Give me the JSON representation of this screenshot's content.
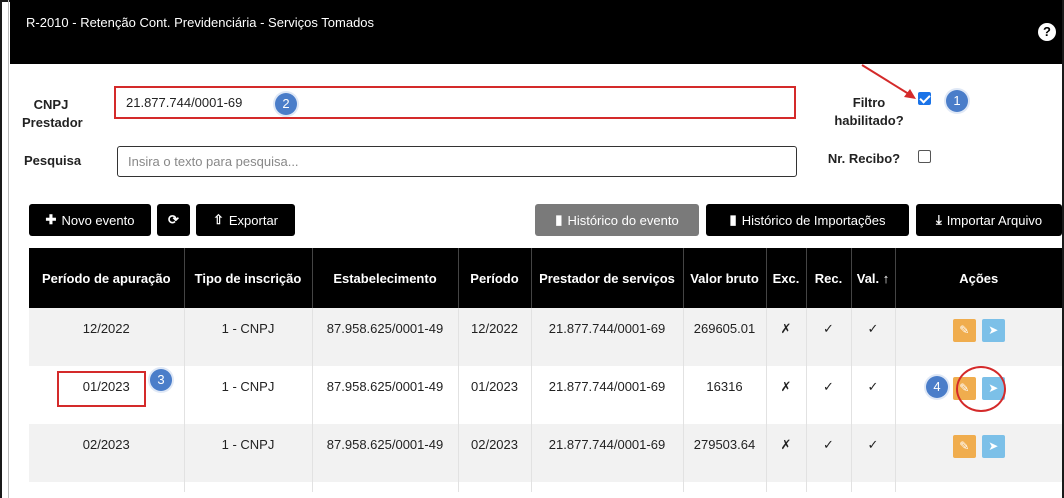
{
  "header": {
    "title": "R-2010 - Retenção Cont. Previdenciária - Serviços Tomados",
    "help_icon": "question-circle-icon"
  },
  "filters": {
    "cnpj_label": "CNPJ Prestador",
    "cnpj_value": "21.877.744/0001-69",
    "search_label": "Pesquisa",
    "search_placeholder": "Insira o texto para pesquisa...",
    "filtro_label": "Filtro habilitado?",
    "filtro_checked": true,
    "recibo_label": "Nr. Recibo?",
    "recibo_checked": false
  },
  "toolbar": {
    "novo_evento": "Novo evento",
    "refresh_icon": "refresh-icon",
    "exportar": "Exportar",
    "historico_evento": "Histórico do evento",
    "historico_importacoes": "Histórico de Importações",
    "importar_arquivo": "Importar Arquivo"
  },
  "table": {
    "columns": [
      "Período de apuração",
      "Tipo de inscrição",
      "Estabelecimento",
      "Período",
      "Prestador de serviços",
      "Valor bruto",
      "Exc.",
      "Rec.",
      "Val. ↑",
      "Ações"
    ],
    "rows": [
      {
        "apuracao": "12/2022",
        "tipo": "1 - CNPJ",
        "estab": "87.958.625/0001-49",
        "periodo": "12/2022",
        "prestador": "21.877.744/0001-69",
        "valor": "269605.01",
        "exc": "✗",
        "rec": "✓",
        "val": "✓"
      },
      {
        "apuracao": "01/2023",
        "tipo": "1 - CNPJ",
        "estab": "87.958.625/0001-49",
        "periodo": "01/2023",
        "prestador": "21.877.744/0001-69",
        "valor": "16316",
        "exc": "✗",
        "rec": "✓",
        "val": "✓"
      },
      {
        "apuracao": "02/2023",
        "tipo": "1 - CNPJ",
        "estab": "87.958.625/0001-49",
        "periodo": "02/2023",
        "prestador": "21.877.744/0001-69",
        "valor": "279503.64",
        "exc": "✗",
        "rec": "✓",
        "val": "✓"
      }
    ]
  },
  "annotations": {
    "badge1": "1",
    "badge2": "2",
    "badge3": "3",
    "badge4": "4"
  },
  "colors": {
    "header_bg": "#000000",
    "annotation_red": "#d42a2a",
    "badge_blue": "#4a7dc9",
    "edit_orange": "#f0ad4e",
    "send_blue": "#7cc0e8"
  }
}
